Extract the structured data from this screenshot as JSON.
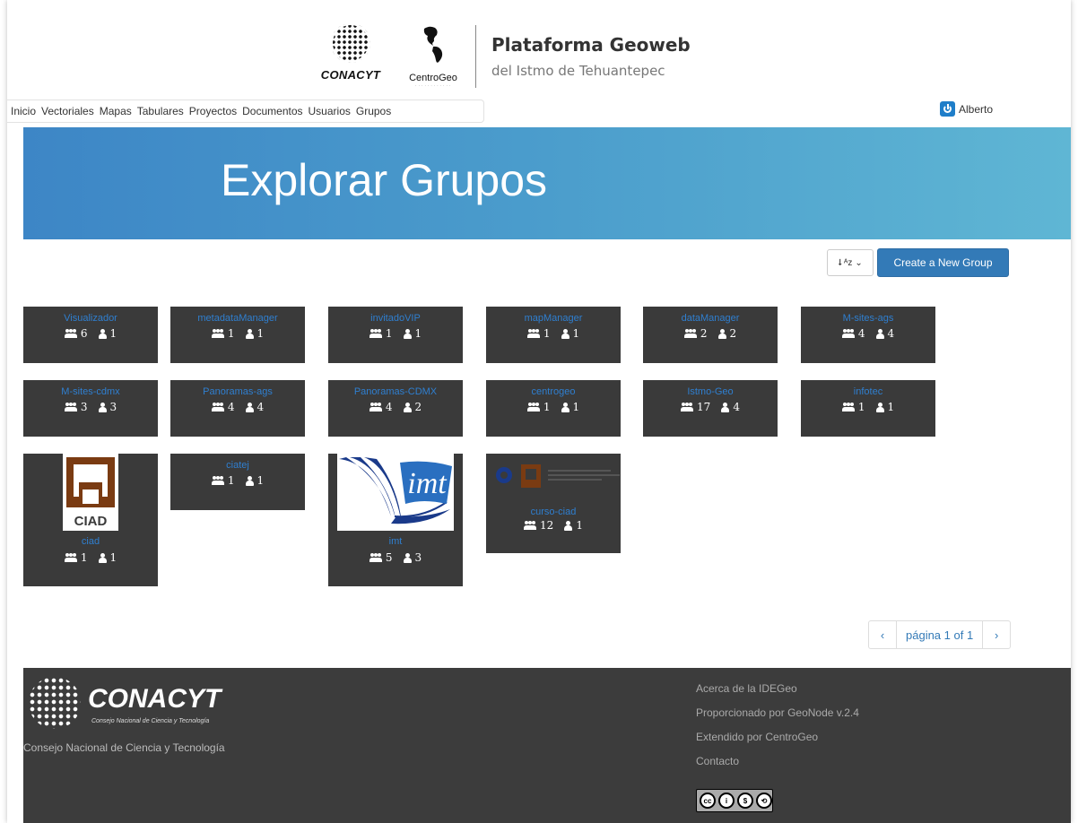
{
  "header": {
    "logo1_text": "CONACYT",
    "logo2_text": "CentroGeo",
    "title": "Plataforma Geoweb",
    "subtitle": "del Istmo de Tehuantepec"
  },
  "nav": {
    "items": [
      "Inicio",
      "Vectoriales",
      "Mapas",
      "Tabulares",
      "Proyectos",
      "Documentos",
      "Usuarios",
      "Grupos"
    ]
  },
  "user": {
    "name": "Alberto"
  },
  "banner": {
    "title": "Explorar Grupos"
  },
  "toolbar": {
    "create_label": "Create a New Group"
  },
  "groups": [
    {
      "name": "Visualizador",
      "managers": "6",
      "members": "1"
    },
    {
      "name": "metadataManager",
      "managers": "1",
      "members": "1"
    },
    {
      "name": "invitadoVIP",
      "managers": "1",
      "members": "1"
    },
    {
      "name": "mapManager",
      "managers": "1",
      "members": "1"
    },
    {
      "name": "dataManager",
      "managers": "2",
      "members": "2"
    },
    {
      "name": "M-sites-ags",
      "managers": "4",
      "members": "4"
    },
    {
      "name": "M-sites-cdmx",
      "managers": "3",
      "members": "3"
    },
    {
      "name": "Panoramas-ags",
      "managers": "4",
      "members": "4"
    },
    {
      "name": "Panoramas-CDMX",
      "managers": "4",
      "members": "2"
    },
    {
      "name": "centrogeo",
      "managers": "1",
      "members": "1"
    },
    {
      "name": "Istmo-Geo",
      "managers": "17",
      "members": "4"
    },
    {
      "name": "infotec",
      "managers": "1",
      "members": "1"
    },
    {
      "name": "ciad",
      "managers": "1",
      "members": "1",
      "logo_text": "CIAD"
    },
    {
      "name": "ciatej",
      "managers": "1",
      "members": "1"
    },
    {
      "name": "imt",
      "managers": "5",
      "members": "3",
      "logo_text": "imt"
    },
    {
      "name": "curso-ciad",
      "managers": "12",
      "members": "1"
    }
  ],
  "pagination": {
    "prev": "‹",
    "label": "página 1 of 1",
    "next": "›"
  },
  "footer": {
    "logo_text": "CONACYT",
    "logo_sub": "Consejo Nacional de Ciencia y Tecnología",
    "org_name": "Consejo Nacional de Ciencia y Tecnología",
    "links": [
      "Acerca de la IDEGeo",
      "Proporcionado por GeoNode v.2.4",
      "Extendido por CentroGeo",
      "Contacto"
    ],
    "license_text": "BY NC SA"
  },
  "colors": {
    "banner": "#4b9dcc",
    "accent": "#337ab7",
    "card_bg": "#3a3a3a",
    "footer_bg": "#3c3c3c"
  }
}
